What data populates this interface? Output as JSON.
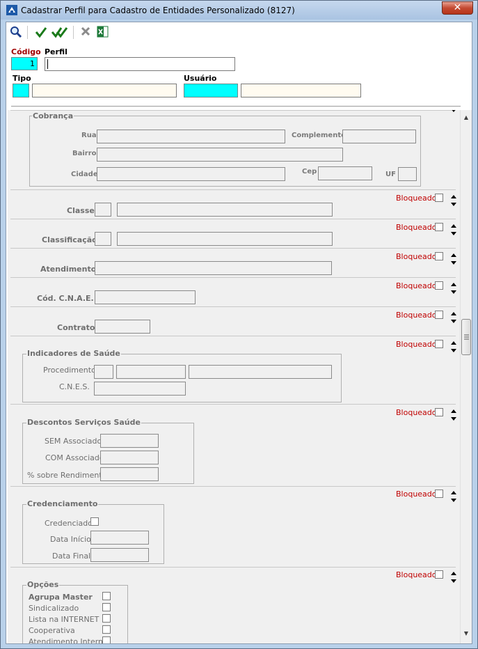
{
  "window": {
    "title": "Cadastrar Perfil para Cadastro de Entidades Personalizado (8127)"
  },
  "toolbar": {
    "icons": [
      "search-icon",
      "check-icon",
      "double-check-icon",
      "cancel-icon",
      "excel-icon"
    ]
  },
  "header": {
    "codigo_label": "Código",
    "codigo_value": "1",
    "perfil_label": "Perfil",
    "tipo_label": "Tipo",
    "usuario_label": "Usuário"
  },
  "cobranca": {
    "title": "Cobrança",
    "rua": "Rua",
    "complemento": "Complemento",
    "bairro": "Bairro",
    "cidade": "Cidade",
    "cep": "Cep",
    "uf": "UF"
  },
  "bloqueado": "Bloqueado",
  "fields": {
    "classe": "Classe",
    "classificacao": "Classificação",
    "atendimento": "Atendimento",
    "cnae": "Cód. C.N.A.E.",
    "contrato": "Contrato"
  },
  "saude": {
    "title": "Indicadores de Saúde",
    "procedimento": "Procedimento",
    "cnes": "C.N.E.S."
  },
  "descontos": {
    "title": "Descontos Serviços Saúde",
    "sem": "SEM Associado",
    "com": "COM Associado",
    "rendimento": "% sobre Rendimento"
  },
  "credenciamento": {
    "title": "Credenciamento",
    "credenciado": "Credenciado",
    "inicio": "Data Início",
    "final": "Data Final"
  },
  "opcoes": {
    "title": "Opções",
    "agrupa": "Agrupa Master",
    "sindicalizado": "Sindicalizado",
    "internet": "Lista na INTERNET",
    "cooperativa": "Cooperativa",
    "interno": "Atendimento Interno"
  }
}
